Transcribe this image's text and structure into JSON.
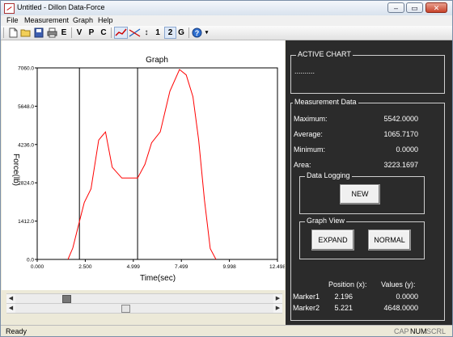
{
  "window": {
    "title": "Untitled - Dillon Data-Force",
    "minimize": "–",
    "restore": "▭",
    "close": "✕"
  },
  "menu": [
    "File",
    "Measurement",
    "Graph",
    "Help"
  ],
  "toolbar": {
    "icons": [
      "new-file-icon",
      "open-folder-icon",
      "save-disk-icon",
      "print-icon"
    ],
    "buttons": [
      "E",
      "V",
      "P",
      "C"
    ],
    "cursor_arrows": "↕",
    "one": "1",
    "two": "2",
    "g": "G",
    "help": "?"
  },
  "chart_data": {
    "type": "line",
    "title": "Graph",
    "xlabel": "Time(sec)",
    "ylabel": "Force(lb)",
    "xlim": [
      0,
      12.498
    ],
    "ylim": [
      0,
      7060
    ],
    "x_ticks": [
      "0.000",
      "2.500",
      "4.999",
      "7.499",
      "9.998",
      "12.498"
    ],
    "y_ticks": [
      "0.0",
      "1412.0",
      "2824.0",
      "4236.0",
      "5648.0",
      "7060.0"
    ],
    "markers_x": [
      2.196,
      5.221
    ],
    "color": "#ff0000",
    "x": [
      1.6,
      1.85,
      2.196,
      2.45,
      2.8,
      3.2,
      3.55,
      3.9,
      4.4,
      4.85,
      5.221,
      5.6,
      5.95,
      6.4,
      6.9,
      7.4,
      7.75,
      8.1,
      8.4,
      8.7,
      9.0,
      9.3
    ],
    "y": [
      0,
      420,
      1400,
      2100,
      2600,
      4400,
      4700,
      3400,
      3000,
      3000,
      3000,
      3500,
      4300,
      4700,
      6200,
      7000,
      6800,
      6000,
      4400,
      2200,
      400,
      0
    ]
  },
  "right": {
    "active_chart": {
      "title": "ACTIVE CHART",
      "text": ".........."
    },
    "measurement": {
      "title": "Measurement Data",
      "rows": [
        {
          "label": "Maximum:",
          "value": "5542.0000"
        },
        {
          "label": "Average:",
          "value": "1065.7170"
        },
        {
          "label": "Minimum:",
          "value": "0.0000"
        },
        {
          "label": "Area:",
          "value": "3223.1697"
        }
      ]
    },
    "data_logging": {
      "title": "Data Logging",
      "new": "NEW"
    },
    "graph_view": {
      "title": "Graph View",
      "expand": "EXPAND",
      "normal": "NORMAL"
    },
    "markers": {
      "pos_header": "Position (x):",
      "val_header": "Values (y):",
      "rows": [
        {
          "name": "Marker1",
          "pos": "2.196",
          "val": "0.0000"
        },
        {
          "name": "Marker2",
          "pos": "5.221",
          "val": "4648.0000"
        }
      ]
    }
  },
  "scroll_arrows": {
    "left": "◀",
    "right": "▶"
  },
  "status": {
    "ready": "Ready",
    "cap": "CAP",
    "num": "NUM",
    "scrl": "SCRL"
  }
}
